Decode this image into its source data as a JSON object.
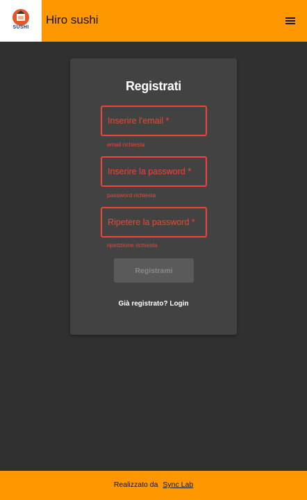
{
  "header": {
    "logo_text": "SUSHI",
    "app_title": "Hiro sushi",
    "menu_icon": "hamburger-menu-icon"
  },
  "form": {
    "title": "Registrati",
    "email": {
      "placeholder": "Inserire l'email *",
      "value": "",
      "error": "email richiesta"
    },
    "password": {
      "placeholder": "Inserire la password *",
      "value": "",
      "error": "password richiesta"
    },
    "password_repeat": {
      "placeholder": "Ripetere la password *",
      "value": "",
      "error": "ripetizione richiesta"
    },
    "submit_label": "Registrami",
    "login_link": "Già registrato? Login"
  },
  "footer": {
    "prefix": "Realizzato da",
    "link": "Sync Lab"
  },
  "colors": {
    "accent": "#ff9800",
    "background": "#303030",
    "card": "#424242",
    "error": "#f44336"
  }
}
